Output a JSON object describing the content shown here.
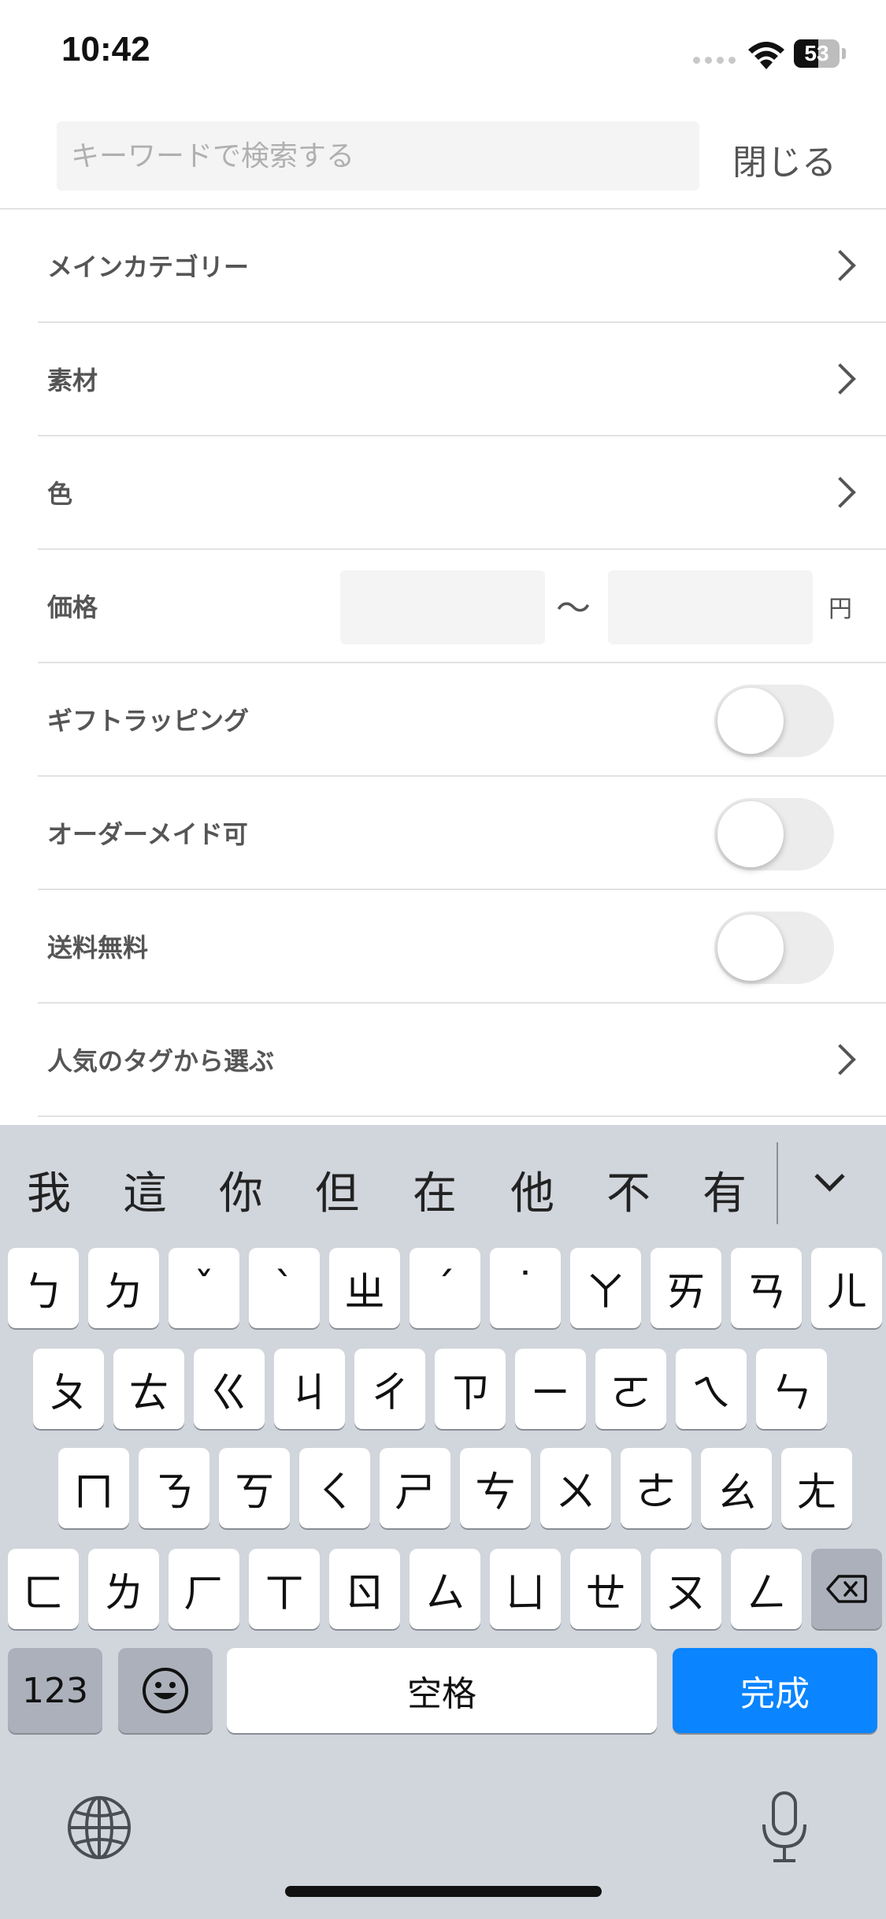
{
  "status_bar": {
    "time": "10:42",
    "battery": "53",
    "battery_level": 0.53
  },
  "search": {
    "placeholder": "キーワードで検索する",
    "close_label": "閉じる"
  },
  "filters": {
    "main_category": "メインカテゴリー",
    "material": "素材",
    "color": "色",
    "price": {
      "label": "価格",
      "separator": "〜",
      "unit": "円"
    },
    "gift_wrapping": {
      "label": "ギフトラッピング",
      "on": false
    },
    "made_to_order": {
      "label": "オーダーメイド可",
      "on": false
    },
    "free_shipping": {
      "label": "送料無料",
      "on": false
    },
    "popular_tags": "人気のタグから選ぶ"
  },
  "keyboard": {
    "candidates": [
      "我",
      "這",
      "你",
      "但",
      "在",
      "他",
      "不",
      "有"
    ],
    "row1": [
      "ㄅ",
      "ㄉ",
      "ˇ",
      "ˋ",
      "ㄓ",
      "ˊ",
      "˙",
      "ㄚ",
      "ㄞ",
      "ㄢ",
      "ㄦ"
    ],
    "row2": [
      "ㄆ",
      "ㄊ",
      "ㄍ",
      "ㄐ",
      "ㄔ",
      "ㄗ",
      "ㄧ",
      "ㄛ",
      "ㄟ",
      "ㄣ"
    ],
    "row3": [
      "ㄇ",
      "ㄋ",
      "ㄎ",
      "ㄑ",
      "ㄕ",
      "ㄘ",
      "ㄨ",
      "ㄜ",
      "ㄠ",
      "ㄤ"
    ],
    "row4": [
      "ㄈ",
      "ㄌ",
      "ㄏ",
      "ㄒ",
      "ㄖ",
      "ㄙ",
      "ㄩ",
      "ㄝ",
      "ㄡ",
      "ㄥ"
    ],
    "numbers_label": "123",
    "space_label": "空格",
    "done_label": "完成",
    "icons": {
      "emoji": "emoji-icon",
      "backspace": "backspace-icon",
      "globe": "globe-icon",
      "mic": "mic-icon",
      "collapse": "chevron-down-icon"
    }
  }
}
